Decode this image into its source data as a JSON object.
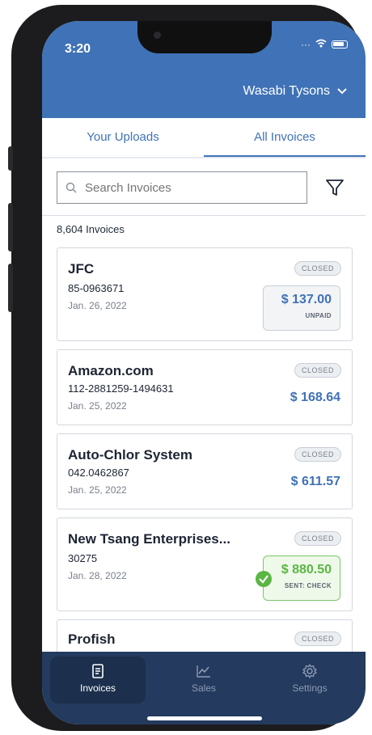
{
  "status_bar": {
    "time": "3:20"
  },
  "header": {
    "store_name": "Wasabi Tysons"
  },
  "tabs": [
    {
      "label": "Your Uploads"
    },
    {
      "label": "All Invoices"
    }
  ],
  "search": {
    "placeholder": "Search Invoices"
  },
  "invoice_count": "8,604 Invoices",
  "invoices": [
    {
      "vendor": "JFC",
      "number": "85-0963671",
      "date": "Jan. 26, 2022",
      "status": "CLOSED",
      "amount": "$ 137.00",
      "payment_status": "UNPAID"
    },
    {
      "vendor": "Amazon.com",
      "number": "112-2881259-1494631",
      "date": "Jan. 25, 2022",
      "status": "CLOSED",
      "amount": "$ 168.64"
    },
    {
      "vendor": "Auto-Chlor System",
      "number": "042.0462867",
      "date": "Jan. 25, 2022",
      "status": "CLOSED",
      "amount": "$ 611.57"
    },
    {
      "vendor": "New Tsang Enterprises...",
      "number": "30275",
      "date": "Jan. 28, 2022",
      "status": "CLOSED",
      "amount": "$ 880.50",
      "payment_status": "SENT: CHECK"
    },
    {
      "vendor": "Profish",
      "status": "CLOSED"
    }
  ],
  "tabbar": [
    {
      "label": "Invoices",
      "icon": "invoice-icon"
    },
    {
      "label": "Sales",
      "icon": "chart-icon"
    },
    {
      "label": "Settings",
      "icon": "gear-icon"
    }
  ],
  "colors": {
    "brand_blue": "#3f72b6",
    "paid_green": "#5ab643",
    "tabbar_bg": "#243a5e"
  }
}
